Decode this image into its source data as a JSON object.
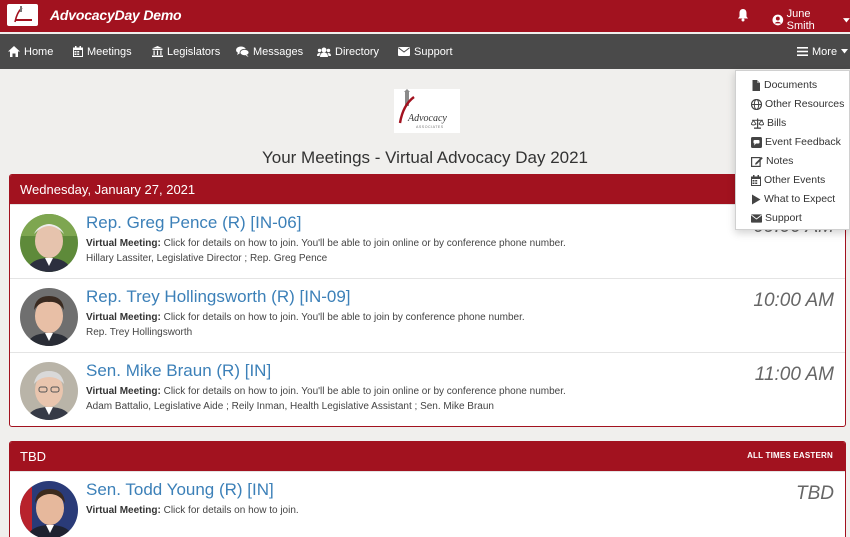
{
  "header": {
    "brand": "AdvocacyDay Demo",
    "user_name": "June Smith"
  },
  "nav": {
    "items": [
      {
        "label": "Home",
        "icon": "home-icon"
      },
      {
        "label": "Meetings",
        "icon": "calendar-icon"
      },
      {
        "label": "Legislators",
        "icon": "institution-icon"
      },
      {
        "label": "Messages",
        "icon": "comments-icon"
      },
      {
        "label": "Directory",
        "icon": "users-icon"
      },
      {
        "label": "Support",
        "icon": "envelope-icon"
      }
    ],
    "more_label": "More"
  },
  "more_menu": {
    "items": [
      {
        "label": "Documents",
        "icon": "file-icon"
      },
      {
        "label": "Other Resources",
        "icon": "globe-icon"
      },
      {
        "label": "Bills",
        "icon": "balance-scale-icon"
      },
      {
        "label": "Event Feedback",
        "icon": "comment-box-icon"
      },
      {
        "label": "Notes",
        "icon": "edit-icon"
      },
      {
        "label": "Other Events",
        "icon": "calendar-icon"
      },
      {
        "label": "What to Expect",
        "icon": "play-icon"
      },
      {
        "label": "Support",
        "icon": "envelope-icon"
      }
    ]
  },
  "logo_text": "Advocacy",
  "logo_subtext": "ASSOCIATES",
  "page_title": "Your Meetings - Virtual Advocacy Day 2021",
  "sections": [
    {
      "heading": "Wednesday, January 27, 2021",
      "meetings": [
        {
          "name": "Rep. Greg Pence (R) [IN-06]",
          "type_label": "Virtual Meeting:",
          "details": "Click for details on how to join. You'll be able to join online or by conference phone number.",
          "attendees": "Hillary Lassiter, Legislative Director ; Rep. Greg Pence",
          "time": "09:00 AM"
        },
        {
          "name": "Rep. Trey Hollingsworth (R) [IN-09]",
          "type_label": "Virtual Meeting:",
          "details": "Click for details on how to join. You'll be able to join by conference phone number.",
          "attendees": "Rep. Trey Hollingsworth",
          "time": "10:00 AM"
        },
        {
          "name": "Sen. Mike Braun (R) [IN]",
          "type_label": "Virtual Meeting:",
          "details": "Click for details on how to join. You'll be able to join online or by conference phone number.",
          "attendees": "Adam Battalio, Legislative Aide ; Reily Inman, Health Legislative Assistant ; Sen. Mike Braun",
          "time": "11:00 AM"
        }
      ]
    },
    {
      "heading": "TBD",
      "heading_right": "ALL TIMES EASTERN",
      "meetings": [
        {
          "name": "Sen. Todd Young (R) [IN]",
          "type_label": "Virtual Meeting:",
          "details": "Click for details on how to join.",
          "attendees": "",
          "time": "TBD"
        }
      ]
    }
  ],
  "colors": {
    "brand_red": "#a2121f",
    "nav_gray": "#4a4a4a",
    "link_blue": "#3c80b8",
    "page_bg": "#f0efed"
  }
}
